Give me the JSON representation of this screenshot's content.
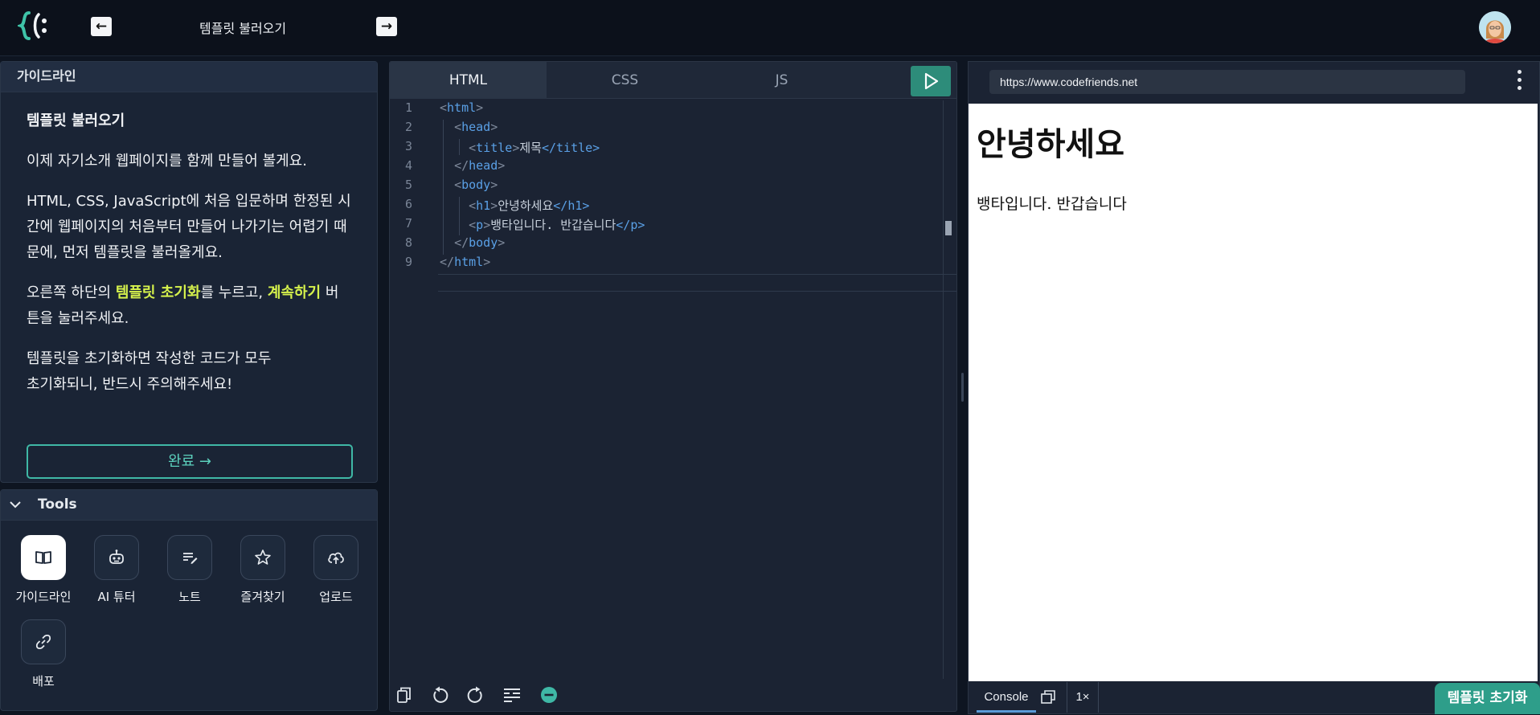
{
  "header": {
    "title": "템플릿 불러오기",
    "back_icon": "arrow-left-icon",
    "forward_icon": "arrow-right-icon"
  },
  "guide": {
    "title": "가이드라인",
    "heading": "템플릿 불러오기",
    "p1": "이제 자기소개 웹페이지를 함께 만들어 볼게요.",
    "p2": "HTML, CSS, JavaScript에 처음 입문하며 한정된 시간에 웹페이지의 처음부터 만들어 나가기는 어렵기 때문에, 먼저 템플릿을 불러올게요.",
    "p3_a": "오른쪽 하단의 ",
    "p3_hl1": "템플릿 초기화",
    "p3_b": "를 누르고, ",
    "p3_hl2": "계속하기",
    "p3_c": " 버튼을 눌러주세요.",
    "p4_a": "템플릿을 초기화하면 작성한 코드가 모두",
    "p4_b": "초기화되니, 반드시 주의해주세요!",
    "done_label": "완료 →",
    "highlight_color": "#d6f24c"
  },
  "tools": {
    "title": "Tools",
    "items": [
      {
        "label": "가이드라인",
        "icon": "book-icon"
      },
      {
        "label": "AI 튜터",
        "icon": "robot-icon"
      },
      {
        "label": "노트",
        "icon": "note-icon"
      },
      {
        "label": "즐겨찾기",
        "icon": "star-icon"
      },
      {
        "label": "업로드",
        "icon": "cloud-upload-icon"
      },
      {
        "label": "배포",
        "icon": "link-icon"
      }
    ]
  },
  "editor": {
    "tabs": [
      "HTML",
      "CSS",
      "JS"
    ],
    "active_tab": "HTML",
    "lines": [
      {
        "n": "1",
        "open": "<",
        "tag": "html",
        "close": ">",
        "text": "",
        "etag": ""
      },
      {
        "n": "2",
        "open": "<",
        "tag": "head",
        "close": ">",
        "text": "",
        "etag": ""
      },
      {
        "n": "3",
        "open": "<",
        "tag": "title",
        "close": ">",
        "text": "제목",
        "etag": "</title>"
      },
      {
        "n": "4",
        "open": "</",
        "tag": "head",
        "close": ">",
        "text": "",
        "etag": ""
      },
      {
        "n": "5",
        "open": "<",
        "tag": "body",
        "close": ">",
        "text": "",
        "etag": ""
      },
      {
        "n": "6",
        "open": "<",
        "tag": "h1",
        "close": ">",
        "text": "안녕하세요",
        "etag": "</h1>"
      },
      {
        "n": "7",
        "open": "<",
        "tag": "p",
        "close": ">",
        "text": "뱅타입니다. 반갑습니다",
        "etag": "</p>"
      },
      {
        "n": "8",
        "open": "</",
        "tag": "body",
        "close": ">",
        "text": "",
        "etag": ""
      },
      {
        "n": "9",
        "open": "</",
        "tag": "html",
        "close": ">",
        "text": "",
        "etag": ""
      }
    ]
  },
  "preview": {
    "url": "https://www.codefriends.net",
    "h1": "안녕하세요",
    "p": "뱅타입니다. 반갑습니다",
    "console_label": "Console",
    "speed_label": "1×"
  },
  "reset_label": "템플릿 초기화",
  "colors": {
    "accent": "#2e9e8a",
    "background": "#0e1521",
    "panel": "#1a2435"
  }
}
